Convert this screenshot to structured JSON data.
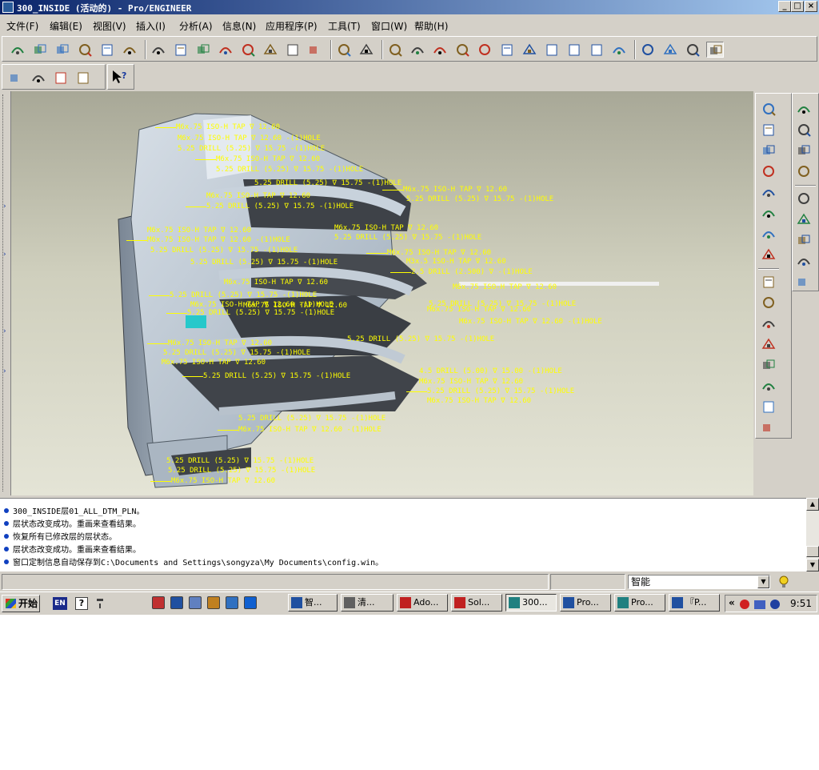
{
  "window": {
    "title": "300_INSIDE (活动的) - Pro/ENGINEER",
    "controls": {
      "minimize": "_",
      "maximize": "□",
      "close": "×"
    }
  },
  "menu": [
    "文件(F)",
    "编辑(E)",
    "视图(V)",
    "插入(I)",
    "分析(A)",
    "信息(N)",
    "应用程序(P)",
    "工具(T)",
    "窗口(W)",
    "帮助(H)"
  ],
  "toolbar": {
    "icons": [
      "new-icon",
      "open-icon",
      "save-icon",
      "print-icon",
      "email-icon",
      "email-link-icon",
      "undo-icon",
      "redo-icon",
      "cut-icon",
      "copy-icon",
      "paste-icon",
      "paste-special-icon",
      "regenerate-icon",
      "regen-manager-icon",
      "find-icon",
      "select-box-icon",
      "repaint-icon",
      "spin-center-icon",
      "orient-icon",
      "pan-icon",
      "zoom-in-icon",
      "zoom-out-icon",
      "refit-icon",
      "reorient-icon",
      "saved-views-icon",
      "layers-icon",
      "view-manager-icon",
      "wireframe-icon",
      "hidden-line-icon",
      "no-hidden-icon",
      "shading-icon"
    ],
    "row2_icons": [
      "datum-plane-display-icon",
      "datum-axis-display-icon",
      "datum-point-display-icon",
      "csys-display-icon",
      "whats-this-icon"
    ]
  },
  "annotations": [
    "M6x.75 ISO-H TAP ∇ 12.60",
    "M6x.75 ISO-H TAP ∇ 12.60 -(1)HOLE",
    "5.25 DRILL (5.25) ∇ 15.75 -(1)HOLE",
    "M6x.75 ISO-H TAP ∇ 12.60",
    "5.25 DRILL (5.25) ∇ 15.75 -(1)HOLE",
    "5.25 DRILL (5.25) ∇ 15.75 -(1)HOLE",
    "M6x.75 ISO-H TAP ∇ 12.60",
    "M6x.75 ISO-H TAP ∇ 12.60",
    "5.25 DRILL (5.25) ∇ 15.75 -(1)HOLE",
    "5.25 DRILL (5.25) ∇ 15.75 -(1)HOLE",
    "M6x.75 ISO-H TAP ∇ 12.60",
    "M6x.75 ISO-H TAP ∇ 12.60",
    "M6x.75 ISO-H TAP ∇ 12.60 -(1)HOLE",
    "5.25 DRILL (5.25) ∇ 15.75 -(1)HOLE",
    "5.25 DRILL (5.25) ∇ 15.75 -(1)HOLE",
    "M6x.75 ISO-H TAP ∇ 12.60",
    "5.25 DRILL (5.25) ∇ 15.75 -(1)HOLE",
    "M3x.5 ISO-H TAP ∇ 12.60",
    "2.5 DRILL (2.500) ∇ -(1)HOLE",
    "M6x.75 ISO-H TAP ∇ 12.60",
    "M6x.75 ISO-H TAP ∇ 12.60",
    "5.25 DRILL (5.25) ∇ 15.75 -(1)HOLE",
    "M6x.75 ISO-H TAP ∇ 12.60 -(1)HOLE",
    "M6x.75 ISO-H TAP ∇ 12.60",
    "5.25 DRILL (5.25) ∇ 15.75 -(1)HOLE",
    "5.25 DRILL (5.25) ∇ 15.75 -(1)HOLE",
    "M6x.75 ISO-H TAP ∇ 12.60",
    "M6x.75 ISO-H TAP ∇ 12.60",
    "5.25 DRILL (5.25) ∇ 15.75 -(1)HOLE",
    "M6x.75 ISO-H TAP ∇ 12.60",
    "5.25 DRILL (5.25) ∇ 15.75 -(1)HOLE",
    "4.5 DRILL (5.00) ∇ 15.00 -(1)HOLE",
    "M6x.75 ISO-H TAP ∇ 12.60",
    "5.25 DRILL (5.25) ∇ 15.75 -(1)HOLE",
    "M6x.75 ISO-H TAP ∇ 12.60",
    "5.25 DRILL (5.25) ∇ 15.75 -(1)HOLE",
    "M6x.75 ISO-H TAP ∇ 12.60 -(1)HOLE",
    "5.25 DRILL (5.25) ∇ 15.75 -(1)HOLE",
    "5.25 DRILL (5.25) ∇ 15.75 -(1)HOLE",
    "M6x.75 ISO-H TAP ∇ 12.60",
    "M6x.75 ISO-H TAP ∇ 12.60 -(1)HOLE",
    "5.25 DRILL (5.25) ∇ 15.75 -(1)HOLE"
  ],
  "right_palette_icons": [
    "sketch-tool-icon",
    "datum-plane-icon",
    "datum-axis-icon",
    "datum-curve-icon",
    "datum-point-icon",
    "csys-icon",
    "analysis-feature-icon",
    "sketched-datum-icon",
    "extrude-icon",
    "revolve-icon",
    "sweep-icon",
    "blend-icon",
    "hole-icon",
    "shell-icon",
    "rib-icon",
    "draft-icon"
  ],
  "right_palette2_icons": [
    "round-icon",
    "chamfer-icon",
    "pattern-icon",
    "mirror-icon",
    "merge-icon",
    "trim-icon",
    "offset-icon",
    "thicken-icon",
    "solidify-icon"
  ],
  "messages": [
    "300_INSIDE层01_ALL_DTM_PLN。",
    "层状态改变成功。重画来查看结果。",
    "恢复所有已修改层的层状态。",
    "层状态改变成功。重画来查看结果。",
    "窗口定制信息自动保存到C:\\Documents and Settings\\songyza\\My Documents\\config.win。"
  ],
  "status": {
    "filter": "智能"
  },
  "taskbar": {
    "start": "开始",
    "lang": "EN",
    "tasks": [
      "智...",
      "清...",
      "Ado...",
      "Sol...",
      "300...",
      "Pro...",
      "Pro...",
      "『P..."
    ],
    "active_task": "300...",
    "clock": "9:51"
  },
  "colors": {
    "annotation": "#ffff00",
    "titlebar": "#0a246a",
    "model": "#b8c4cf"
  }
}
